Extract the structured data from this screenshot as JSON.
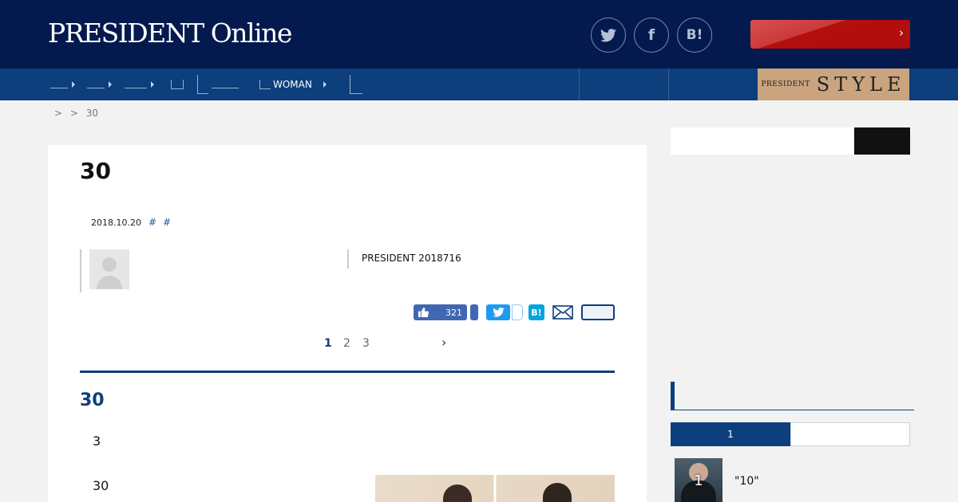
{
  "header": {
    "logo_text": "PRESIDENT Online",
    "social": [
      {
        "name": "twitter-icon",
        "glyph": "🐦"
      },
      {
        "name": "facebook-icon",
        "glyph": "f"
      },
      {
        "name": "hatena-bookmark-icon",
        "glyph": "B!"
      }
    ],
    "login_label": "",
    "login_chevron": "›"
  },
  "nav": {
    "items": [
      {
        "label": "",
        "caret": true
      },
      {
        "label": "",
        "caret": true
      },
      {
        "label": "",
        "caret": true
      },
      {
        "label": "",
        "caret": false
      },
      {
        "label": "",
        "caret": false
      },
      {
        "label": "WOMAN",
        "caret": true
      },
      {
        "label": "",
        "caret": false
      }
    ],
    "style_banner": {
      "small": "PRESIDENT",
      "big": "STYLE"
    }
  },
  "breadcrumb": {
    "text": "> > 30"
  },
  "article": {
    "title": "30",
    "date": "2018.10.20",
    "tags": [
      "#",
      "#"
    ],
    "source": "PRESIDENT 2018716",
    "like_count": "321",
    "hatena_label": "B!",
    "pagination": {
      "pages": [
        "1",
        "2",
        "3"
      ],
      "current": "1",
      "next": "›"
    },
    "section_title": "30",
    "paragraphs": [
      "3",
      "30"
    ]
  },
  "sidebar": {
    "search_placeholder": "",
    "search_button": "",
    "ranking_header": "",
    "tabs": [
      "1",
      ""
    ],
    "ranking_items": [
      {
        "rank": "1",
        "title": "\"10\""
      }
    ]
  },
  "colors": {
    "header_bg": "#041a4e",
    "nav_bg": "#0c3f7c",
    "login_red": "#b00d0d",
    "accent_blue": "#0c3f7c",
    "style_gold": "#c9a47e"
  }
}
